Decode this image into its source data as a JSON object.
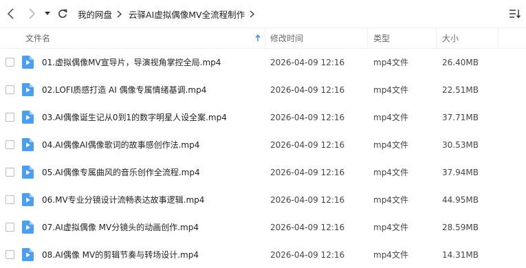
{
  "toolbar": {
    "breadcrumbs": [
      "我的网盘",
      "云驿AI虚拟偶像MV全流程制作"
    ]
  },
  "columns": {
    "name": "文件名",
    "modified": "修改时间",
    "type": "类型",
    "size": "大小"
  },
  "files": [
    {
      "name": "01.虚拟偶像MV宣导片，导演视角掌控全局.mp4",
      "modified": "2026-04-09 12:16",
      "type": "mp4文件",
      "size": "26.40MB"
    },
    {
      "name": "02.LOFI质感打造 AI 偶像专属情绪基调.mp4",
      "modified": "2026-04-09 12:16",
      "type": "mp4文件",
      "size": "22.51MB"
    },
    {
      "name": "03.AI偶像诞生记从0到1的数字明星人设全案.mp4",
      "modified": "2026-04-09 12:16",
      "type": "mp4文件",
      "size": "37.71MB"
    },
    {
      "name": "04.AI偶像AI偶像歌词的故事感创作法.mp4",
      "modified": "2026-04-09 12:16",
      "type": "mp4文件",
      "size": "30.53MB"
    },
    {
      "name": "05.AI偶像专属曲风的音乐创作全流程.mp4",
      "modified": "2026-04-09 12:16",
      "type": "mp4文件",
      "size": "37.94MB"
    },
    {
      "name": "06.MV专业分镜设计流畅表达故事逻辑.mp4",
      "modified": "2026-04-09 12:16",
      "type": "mp4文件",
      "size": "44.95MB"
    },
    {
      "name": "07.AI虚拟偶像 MV分镜头的动画创作.mp4",
      "modified": "2026-04-09 12:16",
      "type": "mp4文件",
      "size": "28.59MB"
    },
    {
      "name": "08.AI偶像 MV的剪辑节奏与转场设计.mp4",
      "modified": "2026-04-09 12:16",
      "type": "mp4文件",
      "size": "14.31MB"
    }
  ],
  "colors": {
    "file_icon": "#4a9ff5",
    "sort_arrow": "#3a8ee6"
  }
}
